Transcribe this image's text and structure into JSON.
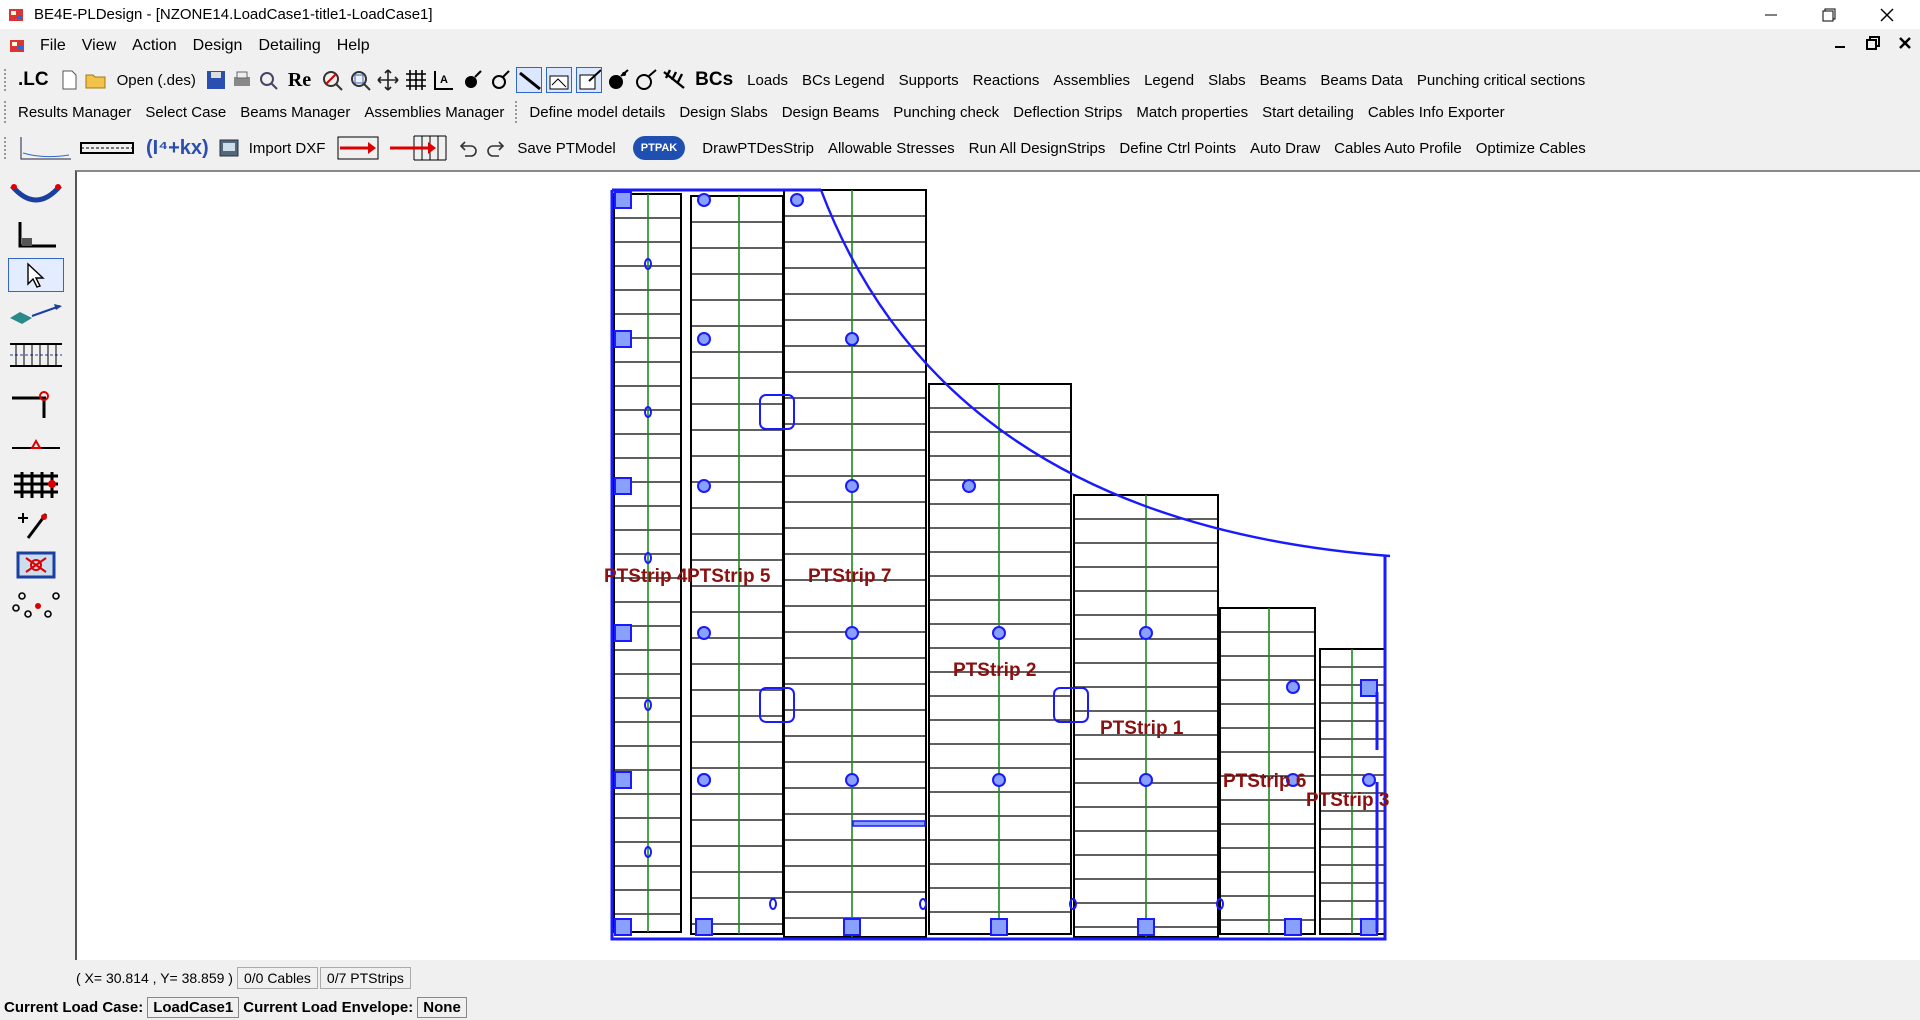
{
  "window": {
    "title": "BE4E-PLDesign - [NZONE14.LoadCase1-title1-LoadCase1]"
  },
  "menu": [
    "File",
    "View",
    "Action",
    "Design",
    "Detailing",
    "Help"
  ],
  "toolbar1": {
    "lc": ".LC",
    "open": "Open (.des)",
    "re": "Re",
    "bcs": "BCs",
    "items": [
      "Loads",
      "BCs Legend",
      "Supports",
      "Reactions",
      "Assemblies",
      "Legend",
      "Slabs",
      "Beams",
      "Beams Data",
      "Punching critical sections"
    ]
  },
  "toolbar2": {
    "items": [
      "Results Manager",
      "Select Case",
      "Beams Manager",
      "Assemblies Manager"
    ],
    "items2": [
      "Define model details",
      "Design Slabs",
      "Design Beams",
      "Punching check",
      "Deflection Strips",
      "Match properties",
      "Start detailing",
      "Cables Info Exporter"
    ]
  },
  "toolbar3": {
    "formula": "(I⁴+kx)",
    "import": "Import DXF",
    "save": "Save PTModel",
    "ptpak": "PTPAK",
    "items": [
      "DrawPTDesStrip",
      "Allowable Stresses",
      "Run All DesignStrips",
      "Define Ctrl Points",
      "Auto Draw",
      "Cables Auto Profile",
      "Optimize Cables"
    ]
  },
  "canvas": {
    "strip_labels": [
      "PTStrip 4",
      "PTStrip 5",
      "PTStrip 7",
      "PTStrip 2",
      "PTStrip 1",
      "PTStrip 6",
      "PTStrip 3"
    ]
  },
  "status": {
    "coords": "( X= 30.814 , Y= 38.859 )",
    "cables": "0/0 Cables",
    "strips": "0/7 PTStrips"
  },
  "bottom": {
    "load_case_label": "Current Load Case:",
    "load_case": "LoadCase1",
    "envelope_label": "Current Load Envelope:",
    "envelope": "None"
  },
  "colors": {
    "strip_label": "#8b1010",
    "outline": "#1a1aff",
    "centerline": "#1a8a1a"
  }
}
